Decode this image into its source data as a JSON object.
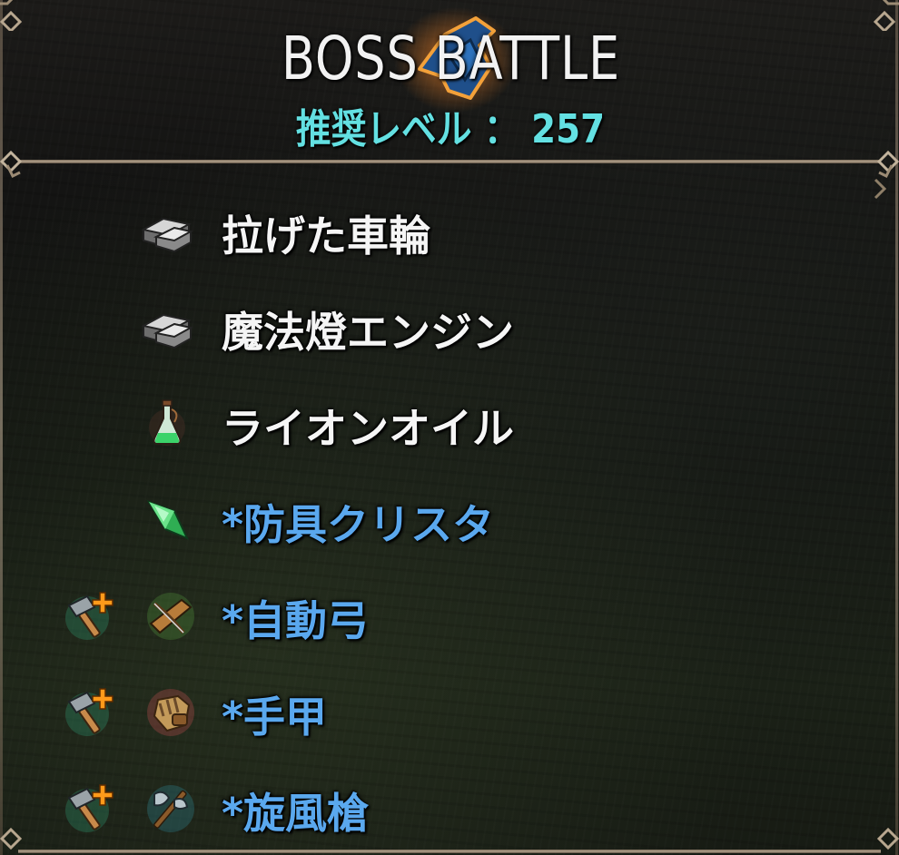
{
  "header": {
    "title": "BOSS BATTLE",
    "recommended_level": "推奨レベル ： 257"
  },
  "items": [
    {
      "name": "拉げた車輪",
      "color": "#f5f5f5",
      "icon": "metal-ingot-icon",
      "has_craft_icon": false
    },
    {
      "name": "魔法燈エンジン",
      "color": "#f5f5f5",
      "icon": "metal-ingot-icon",
      "has_craft_icon": false
    },
    {
      "name": "ライオンオイル",
      "color": "#f5f5f5",
      "icon": "potion-flask-icon",
      "has_craft_icon": false
    },
    {
      "name": "*防具クリスタ",
      "color": "#5aa8ee",
      "icon": "green-crystal-icon",
      "has_craft_icon": false
    },
    {
      "name": "*自動弓",
      "color": "#5aa8ee",
      "icon": "crossbow-icon",
      "has_craft_icon": true,
      "craft_icon": "hammer-plus-icon"
    },
    {
      "name": "*手甲",
      "color": "#5aa8ee",
      "icon": "gauntlet-icon",
      "has_craft_icon": true,
      "craft_icon": "hammer-plus-icon"
    },
    {
      "name": "*旋風槍",
      "color": "#5aa8ee",
      "icon": "halberd-icon",
      "has_craft_icon": true,
      "craft_icon": "hammer-plus-icon"
    }
  ]
}
